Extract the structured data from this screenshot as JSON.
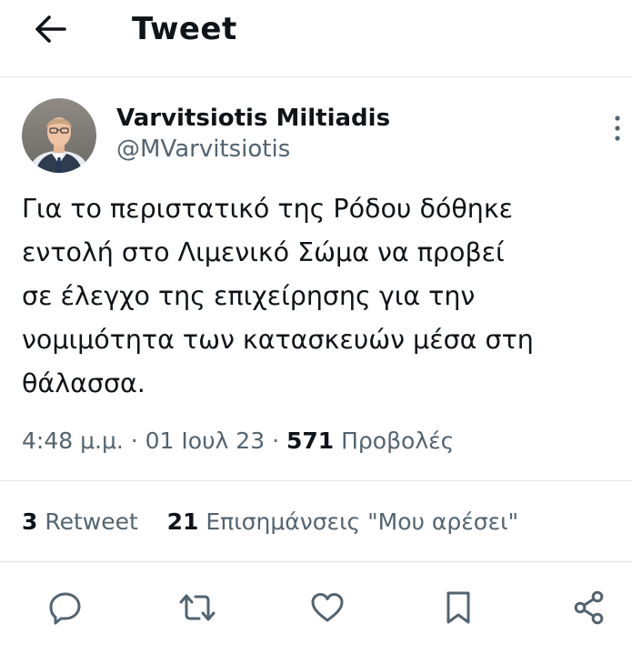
{
  "header": {
    "title": "Tweet",
    "back_icon": "arrow-left-icon"
  },
  "author": {
    "name": "Varvitsiotis Miltiadis",
    "handle": "@MVarvitsiotis",
    "more_icon": "more-vertical-icon"
  },
  "tweet": {
    "text": "Για το περιστατικό της Ρόδου δόθηκε\nεντολή στο Λιμενικό Σώμα να προβεί\nσε έλεγχο της επιχείρησης για την\nνομιμότητα των κατασκευών μέσα στη\nθάλασσα."
  },
  "meta": {
    "time": "4:48 μ.μ.",
    "date": "01 Ιουλ 23",
    "separator": "·",
    "views_count": "571",
    "views_label": "Προβολές"
  },
  "stats": {
    "retweets_count": "3",
    "retweets_label": "Retweet",
    "likes_count": "21",
    "likes_label": "Επισημάνσεις \"Μου αρέσει\""
  },
  "actions": {
    "reply_icon": "reply-icon",
    "retweet_icon": "retweet-icon",
    "like_icon": "heart-icon",
    "bookmark_icon": "bookmark-icon",
    "share_icon": "share-icon"
  },
  "colors": {
    "text_primary": "#0f1419",
    "text_secondary": "#536471",
    "divider": "#e3e6e9",
    "icon": "#536471"
  }
}
